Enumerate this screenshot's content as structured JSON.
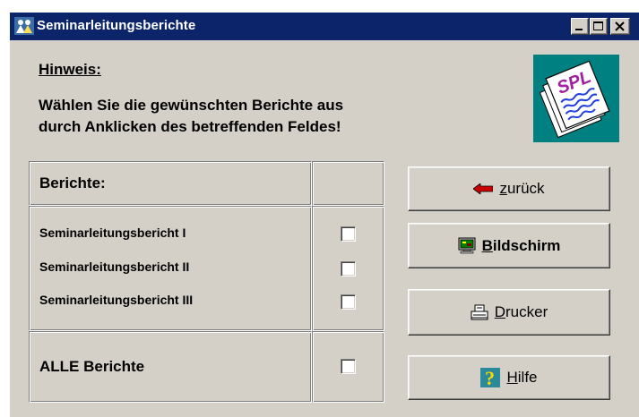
{
  "window": {
    "title": "Seminarleitungsberichte"
  },
  "hint": {
    "title": "Hinweis:",
    "line1": "Wählen Sie die gewünschten Berichte aus",
    "line2": "durch Anklicken des betreffenden Feldes!"
  },
  "logo": {
    "text": "SPL"
  },
  "reports": {
    "header": "Berichte:",
    "items": [
      {
        "label": "Seminarleitungsbericht I",
        "checked": false
      },
      {
        "label": "Seminarleitungsbericht II",
        "checked": false
      },
      {
        "label": "Seminarleitungsbericht III",
        "checked": false
      }
    ],
    "all_label": "ALLE Berichte",
    "all_checked": false
  },
  "buttons": {
    "back": {
      "underlined": "z",
      "rest": "urück",
      "icon": "arrow-left-icon"
    },
    "screen": {
      "underlined": "B",
      "rest": "ildschirm",
      "icon": "monitor-icon"
    },
    "printer": {
      "underlined": "D",
      "rest": "rucker",
      "icon": "printer-icon"
    },
    "help": {
      "underlined": "H",
      "rest": "ilfe",
      "icon": "question-icon"
    }
  },
  "colors": {
    "titlebar": "#0b246a",
    "face": "#d4d0c8",
    "logo_bg": "#008080",
    "arrow": "#cc0000"
  }
}
